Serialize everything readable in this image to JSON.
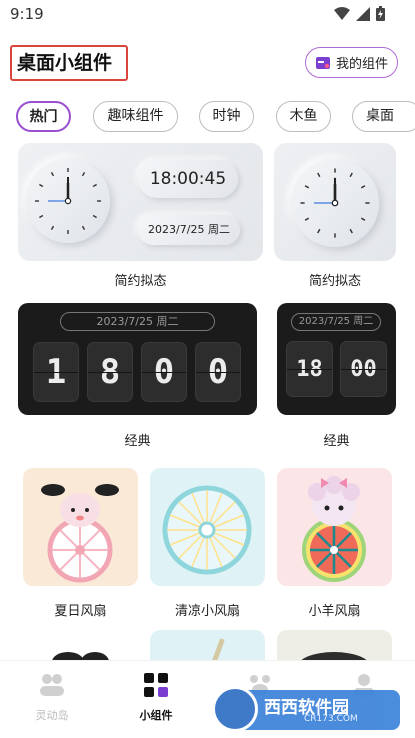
{
  "status_bar": {
    "time": "9:19"
  },
  "header": {
    "title": "桌面小组件",
    "my_widgets_label": "我的组件"
  },
  "tabs": [
    "热门",
    "趣味组件",
    "时钟",
    "木鱼",
    "桌面"
  ],
  "widgets": {
    "neumorphic_large": {
      "time": "18:00:45",
      "date": "2023/7/25 周二",
      "caption": "简约拟态"
    },
    "neumorphic_small": {
      "caption": "简约拟态"
    },
    "flip_large": {
      "date": "2023/7/25 周二",
      "digits": [
        "1",
        "8",
        "0",
        "0"
      ],
      "caption": "经典"
    },
    "flip_small": {
      "date": "2023/7/25 周二",
      "digits": [
        "18",
        "00"
      ],
      "caption": "经典"
    },
    "fans": [
      {
        "caption": "夏日风扇"
      },
      {
        "caption": "清凉小风扇"
      },
      {
        "caption": "小羊风扇"
      }
    ]
  },
  "bottom_nav": [
    {
      "label": "灵动岛"
    },
    {
      "label": "小组件"
    }
  ],
  "watermark": {
    "text": "西西软件园",
    "sub": "CR173.COM"
  },
  "colors": {
    "accent": "#9a4fd0",
    "highlight_box": "#d9453b"
  }
}
